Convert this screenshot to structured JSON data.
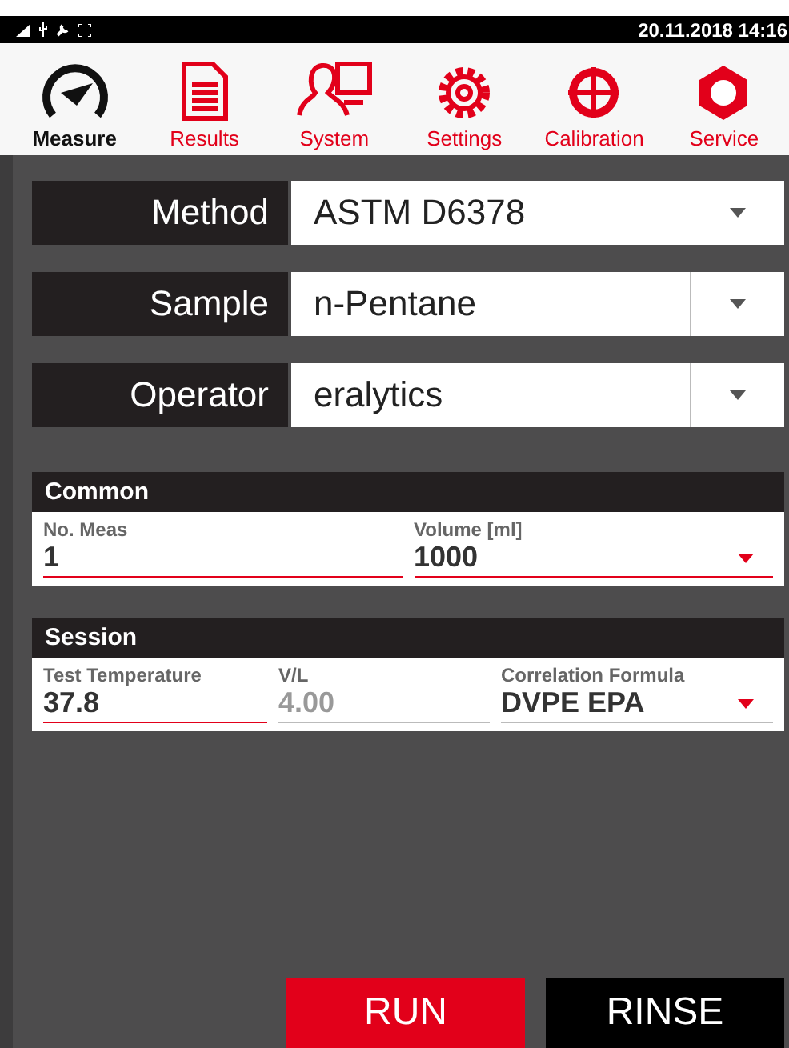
{
  "status_bar": {
    "datetime": "20.11.2018 14:16"
  },
  "nav": [
    {
      "label": "Measure",
      "selected": true
    },
    {
      "label": "Results",
      "selected": false
    },
    {
      "label": "System",
      "selected": false
    },
    {
      "label": "Settings",
      "selected": false
    },
    {
      "label": "Calibration",
      "selected": false
    },
    {
      "label": "Service",
      "selected": false
    }
  ],
  "selectors": [
    {
      "label": "Method",
      "value": "ASTM D6378",
      "split": false
    },
    {
      "label": "Sample",
      "value": "n-Pentane",
      "split": true
    },
    {
      "label": "Operator",
      "value": "eralytics",
      "split": true
    }
  ],
  "sections": [
    {
      "title": "Common",
      "fields": [
        {
          "label": "No. Meas",
          "value": "1",
          "kind": "input",
          "disabled": false,
          "active": true
        },
        {
          "label": "Volume [ml]",
          "value": "1000",
          "kind": "dropdown",
          "disabled": false,
          "active": true
        }
      ]
    },
    {
      "title": "Session",
      "fields": [
        {
          "label": "Test Temperature",
          "value": "37.8",
          "kind": "input",
          "disabled": false,
          "active": true
        },
        {
          "label": "V/L",
          "value": "4.00",
          "kind": "input",
          "disabled": true,
          "active": false
        },
        {
          "label": "Correlation Formula",
          "value": "DVPE EPA",
          "kind": "dropdown",
          "disabled": false,
          "active": false
        }
      ]
    }
  ],
  "buttons": [
    {
      "label": "RUN",
      "kind": "primary"
    },
    {
      "label": "RINSE",
      "kind": "secondary"
    }
  ]
}
